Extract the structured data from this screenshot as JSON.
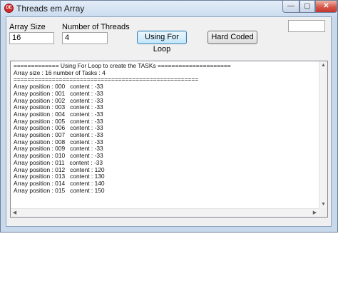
{
  "window": {
    "title": "Threads em Array",
    "app_icon_text": "DE"
  },
  "controls": {
    "minimize": "—",
    "maximize": "▢",
    "close": "✕"
  },
  "form": {
    "array_size_label": "Array Size",
    "array_size_value": "16",
    "num_threads_label": "Number of  Threads",
    "num_threads_value": "4",
    "for_loop_button": "Using For Loop",
    "hard_coded_button": "Hard Coded",
    "extra_field_value": ""
  },
  "log": {
    "lines": [
      "============= Using For Loop to create the TASKs =====================",
      "Array size : 16 number of Tasks : 4",
      "=====================================================",
      "Array position : 000   content : -33",
      "Array position : 001   content : -33",
      "Array position : 002   content : -33",
      "Array position : 003   content : -33",
      "Array position : 004   content : -33",
      "Array position : 005   content : -33",
      "Array position : 006   content : -33",
      "Array position : 007   content : -33",
      "Array position : 008   content : -33",
      "Array position : 009   content : -33",
      "Array position : 010   content : -33",
      "Array position : 011   content : -33",
      "Array position : 012   content : 120",
      "Array position : 013   content : 130",
      "Array position : 014   content : 140",
      "Array position : 015   content : 150"
    ]
  }
}
